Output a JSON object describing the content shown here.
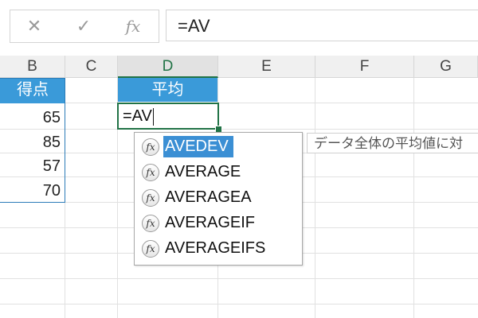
{
  "formula_bar": {
    "cancel_icon": "✕",
    "enter_icon": "✓",
    "function_icon": "fx",
    "formula": "=AV"
  },
  "columns": [
    {
      "label": "B"
    },
    {
      "label": "C"
    },
    {
      "label": "D",
      "active": true
    },
    {
      "label": "E"
    },
    {
      "label": "F"
    },
    {
      "label": "G"
    }
  ],
  "cells": {
    "b_header": "得点",
    "b_values": [
      "65",
      "85",
      "57",
      "70"
    ],
    "d_header": "平均",
    "d_editing": "=AV"
  },
  "autocomplete": {
    "items": [
      "AVEDEV",
      "AVERAGE",
      "AVERAGEA",
      "AVERAGEIF",
      "AVERAGEIFS"
    ],
    "selected": "AVEDEV",
    "icon": "fx"
  },
  "tooltip": "データ全体の平均値に対",
  "colors": {
    "header_fill": "#3a9ad9",
    "selection_green": "#217346",
    "dropdown_highlight": "#3b8fd4"
  }
}
